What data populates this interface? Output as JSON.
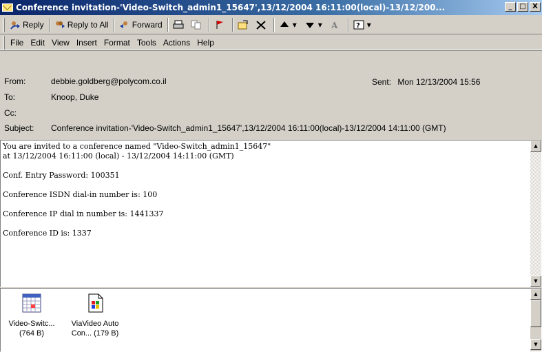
{
  "window": {
    "title": "Conference invitation-'Video-Switch_admin1_15647',13/12/2004 16:11:00(local)-13/12/200...",
    "minimize": "_",
    "maximize": "□",
    "close": "X"
  },
  "toolbar": {
    "reply": "Reply",
    "reply_all": "Reply to All",
    "forward": "Forward"
  },
  "menu": {
    "file": "File",
    "edit": "Edit",
    "view": "View",
    "insert": "Insert",
    "format": "Format",
    "tools": "Tools",
    "actions": "Actions",
    "help": "Help"
  },
  "header": {
    "from_label": "From:",
    "from_value": "debbie.goldberg@polycom.co.il",
    "sent_label": "Sent:",
    "sent_value": "Mon 12/13/2004 15:56",
    "to_label": "To:",
    "to_value": "Knoop, Duke",
    "cc_label": "Cc:",
    "cc_value": "",
    "subject_label": "Subject:",
    "subject_value": "Conference invitation-'Video-Switch_admin1_15647',13/12/2004 16:11:00(local)-13/12/2004 14:11:00 (GMT)"
  },
  "message": {
    "line1": "You are invited to a conference named \"Video-Switch_admin1_15647\"",
    "line2": "at 13/12/2004 16:11:00 (local) - 13/12/2004 14:11:00 (GMT)",
    "password": "Conf. Entry Password: 100351",
    "isdn": "Conference ISDN dial-in number is: 100",
    "ip": "Conference IP dial in number is: 1441337",
    "conf_id": "Conference ID is: 1337"
  },
  "attachments": [
    {
      "name_line1": "Video-Switc...",
      "name_line2": "(764 B)",
      "icon": "calendar-icon"
    },
    {
      "name_line1": "ViaVideo Auto",
      "name_line2": "Con... (179 B)",
      "icon": "document-icon"
    }
  ]
}
